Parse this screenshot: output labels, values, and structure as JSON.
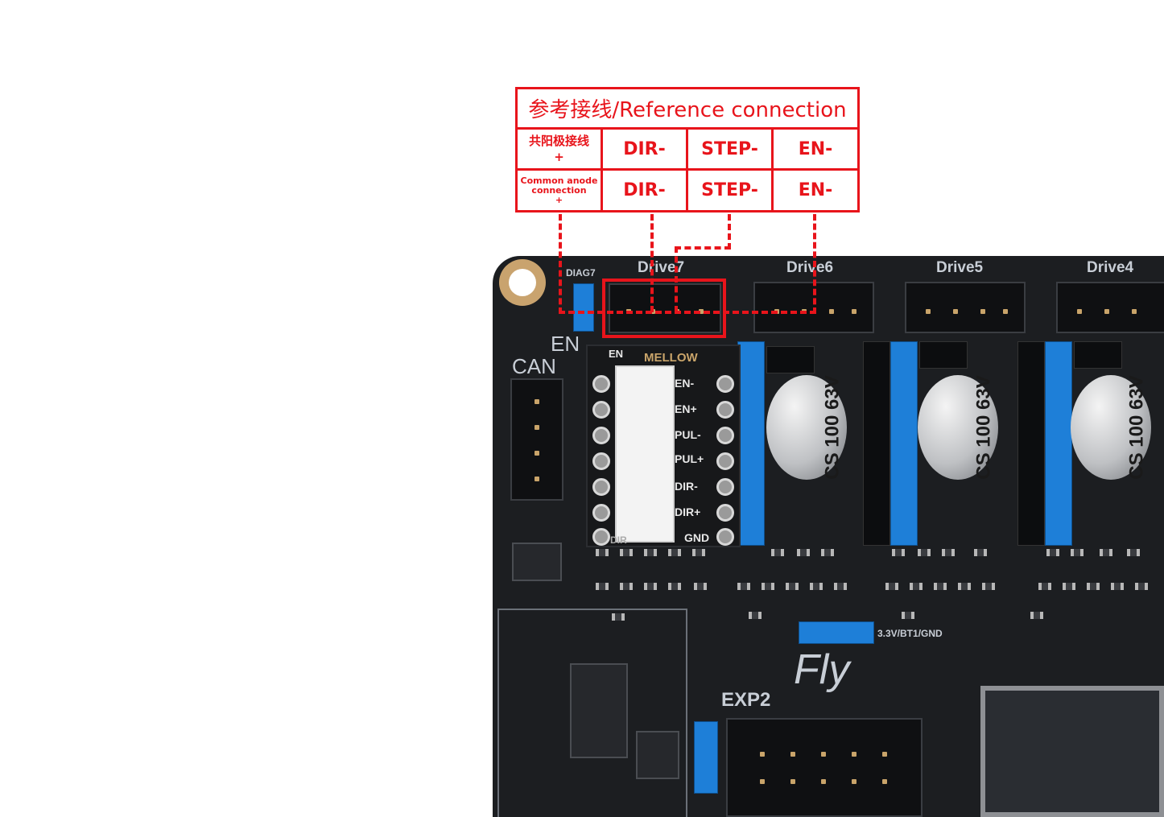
{
  "reference": {
    "title": "参考接线/Reference connection",
    "row1": {
      "label_line1": "共阳极接线",
      "label_line2": "+",
      "signals": [
        "DIR-",
        "STEP-",
        "EN-"
      ]
    },
    "row2": {
      "label_line1": "Common anode",
      "label_line2": "connection",
      "label_line3": "+",
      "signals": [
        "DIR-",
        "STEP-",
        "EN-"
      ]
    }
  },
  "board": {
    "drive_labels": [
      "Drive7",
      "Drive6",
      "Drive5",
      "Drive4"
    ],
    "diag_label": "DIAG7",
    "en_label": "EN",
    "can_label": "CAN",
    "module": {
      "brand": "MELLOW",
      "en_label": "EN",
      "pins": [
        "EN-",
        "EN+",
        "PUL-",
        "PUL+",
        "DIR-",
        "DIR+",
        "GND"
      ],
      "dir_label": "DIR"
    },
    "capacitor": {
      "line1": "CS",
      "line2": "100",
      "line3": "63V"
    },
    "jumper_label": "3.3V/BT1/GND",
    "logo": "Fly",
    "exp_label": "EXP2"
  },
  "colors": {
    "accent_red": "#e8141b",
    "pcb_black": "#1c1e21",
    "header_blue": "#1e7fd8"
  }
}
